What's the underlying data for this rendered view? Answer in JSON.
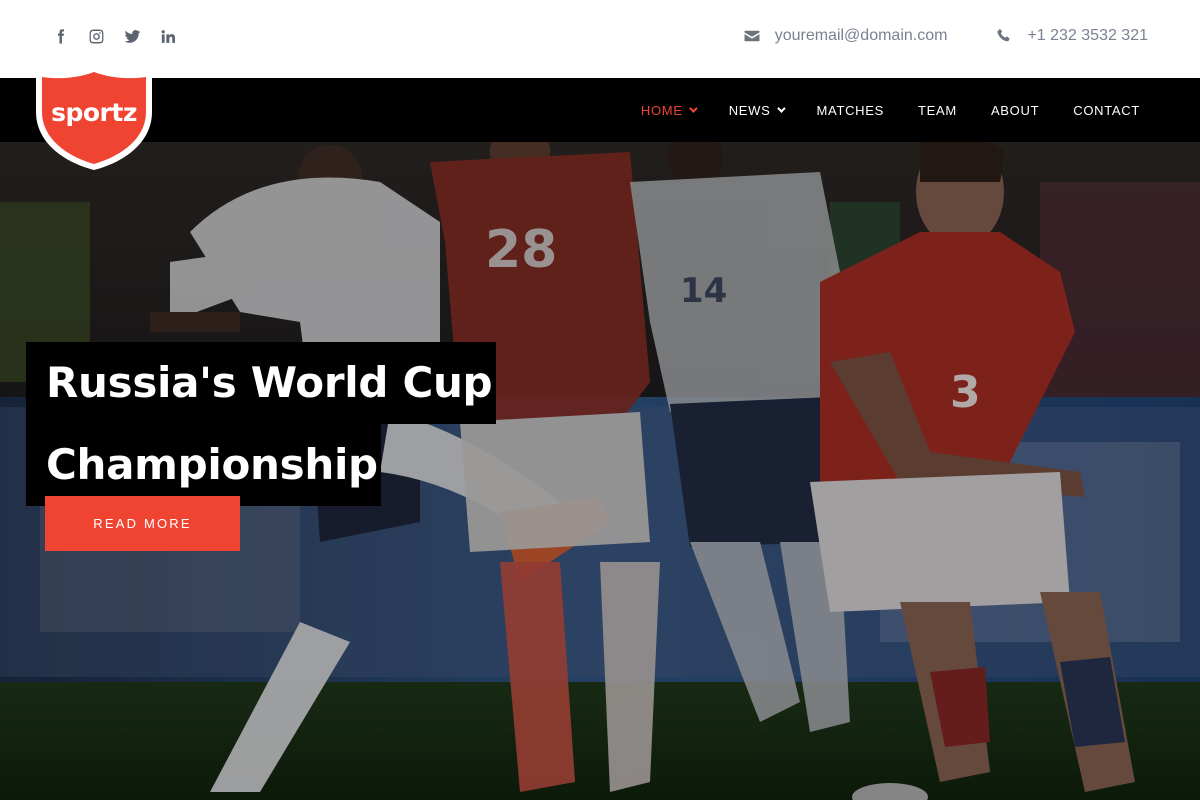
{
  "brand": {
    "name": "sportz",
    "color": "#f04433"
  },
  "social": [
    {
      "name": "facebook-icon"
    },
    {
      "name": "instagram-icon"
    },
    {
      "name": "twitter-icon"
    },
    {
      "name": "linkedin-icon"
    }
  ],
  "contact": {
    "email": "youremail@domain.com",
    "phone": "+1 232 3532 321"
  },
  "nav": {
    "items": [
      {
        "label": "HOME",
        "active": true,
        "has_dropdown": true
      },
      {
        "label": "NEWS",
        "active": false,
        "has_dropdown": true
      },
      {
        "label": "MATCHES",
        "active": false,
        "has_dropdown": false
      },
      {
        "label": "TEAM",
        "active": false,
        "has_dropdown": false
      },
      {
        "label": "ABOUT",
        "active": false,
        "has_dropdown": false
      },
      {
        "label": "CONTACT",
        "active": false,
        "has_dropdown": false
      }
    ]
  },
  "hero": {
    "title_line1": "Russia's World Cup",
    "title_line2": "Championship",
    "cta_label": "READ MORE"
  }
}
